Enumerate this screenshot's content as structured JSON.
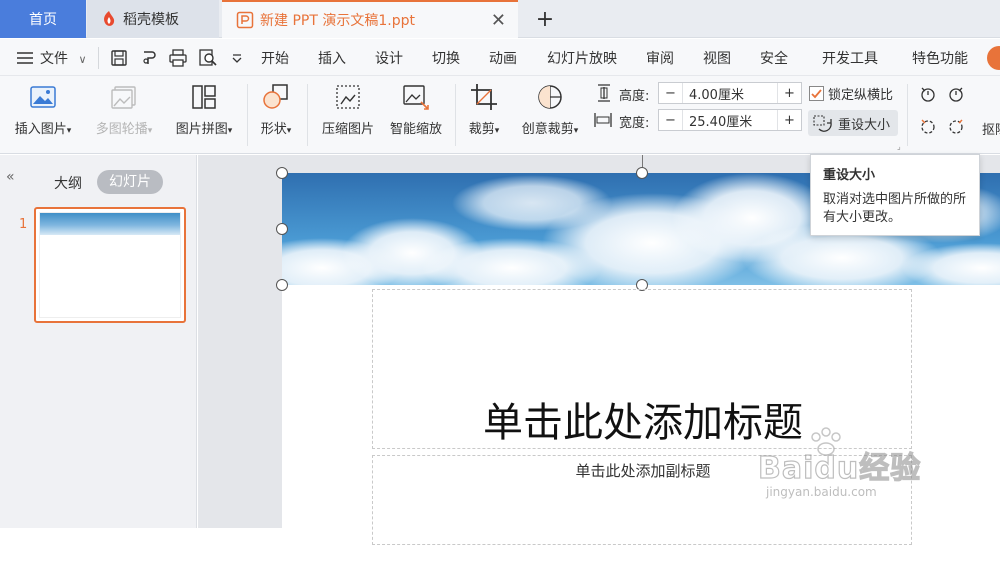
{
  "tabs": {
    "home": "首页",
    "template": "稻壳模板",
    "file": "新建 PPT 演示文稿1.ppt"
  },
  "menubar": {
    "file_menu": "文件",
    "items": [
      "开始",
      "插入",
      "设计",
      "切换",
      "动画",
      "幻灯片放映",
      "审阅",
      "视图",
      "安全",
      "开发工具",
      "特色功能"
    ]
  },
  "ribbon": {
    "insert_picture": "插入图片",
    "multi_carousel": "多图轮播",
    "picture_collage": "图片拼图",
    "shape": "形状",
    "compress_picture": "压缩图片",
    "smart_scale": "智能缩放",
    "crop": "裁剪",
    "creative_crop": "创意裁剪",
    "height_label": "高度:",
    "height_value": "4.00厘米",
    "width_label": "宽度:",
    "width_value": "25.40厘米",
    "lock_ratio": "锁定纵横比",
    "reset_size": "重设大小",
    "cutout_partial": "抠除"
  },
  "tooltip": {
    "title": "重设大小",
    "body": "取消对选中图片所做的所有大小更改。"
  },
  "leftpanel": {
    "outline_tab": "大纲",
    "slides_tab": "幻灯片",
    "slide_number": "1"
  },
  "slide": {
    "title_placeholder": "单击此处添加标题",
    "subtitle_placeholder": "单击此处添加副标题"
  },
  "watermark": {
    "brand": "Baidu经验",
    "url": "jingyan.baidu.com"
  },
  "colors": {
    "home_tab_bg": "#4a7ddc",
    "accent_orange": "#e8733a",
    "sky_blue": "#3f8fc7"
  }
}
